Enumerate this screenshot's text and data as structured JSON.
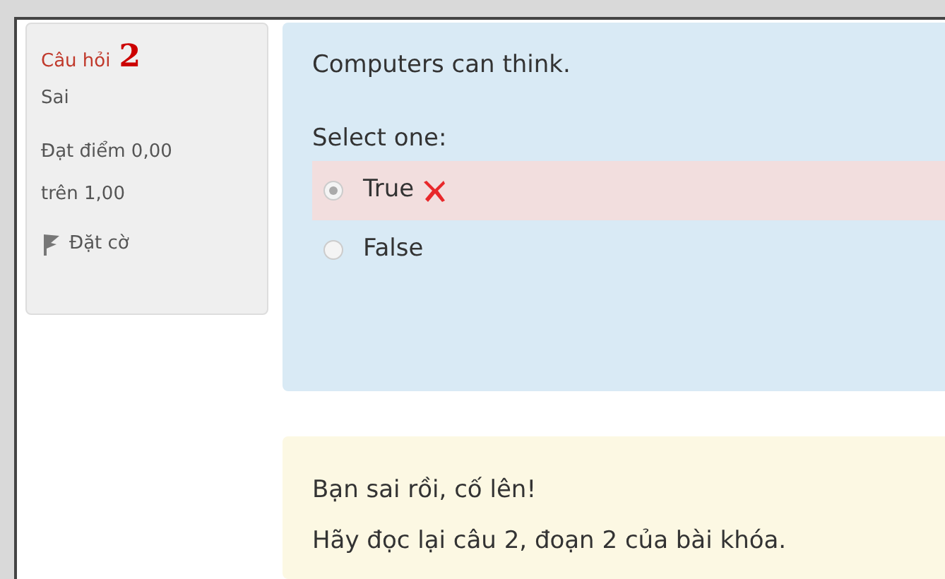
{
  "question_info": {
    "label": "Câu hỏi",
    "number": "2",
    "status": "Sai",
    "grade_line_1": "Đạt điểm 0,00",
    "grade_line_2": "trên 1,00",
    "flag": "Đặt cờ"
  },
  "question": {
    "text": "Computers can think.",
    "prompt": "Select one:",
    "options": [
      {
        "label": "True",
        "selected": true,
        "incorrect": true
      },
      {
        "label": "False",
        "selected": false,
        "incorrect": false
      }
    ]
  },
  "feedback": {
    "lines": [
      "Bạn sai rồi, cố lên!",
      "Hãy đọc lại câu 2, đoạn 2 của bài khóa."
    ]
  }
}
